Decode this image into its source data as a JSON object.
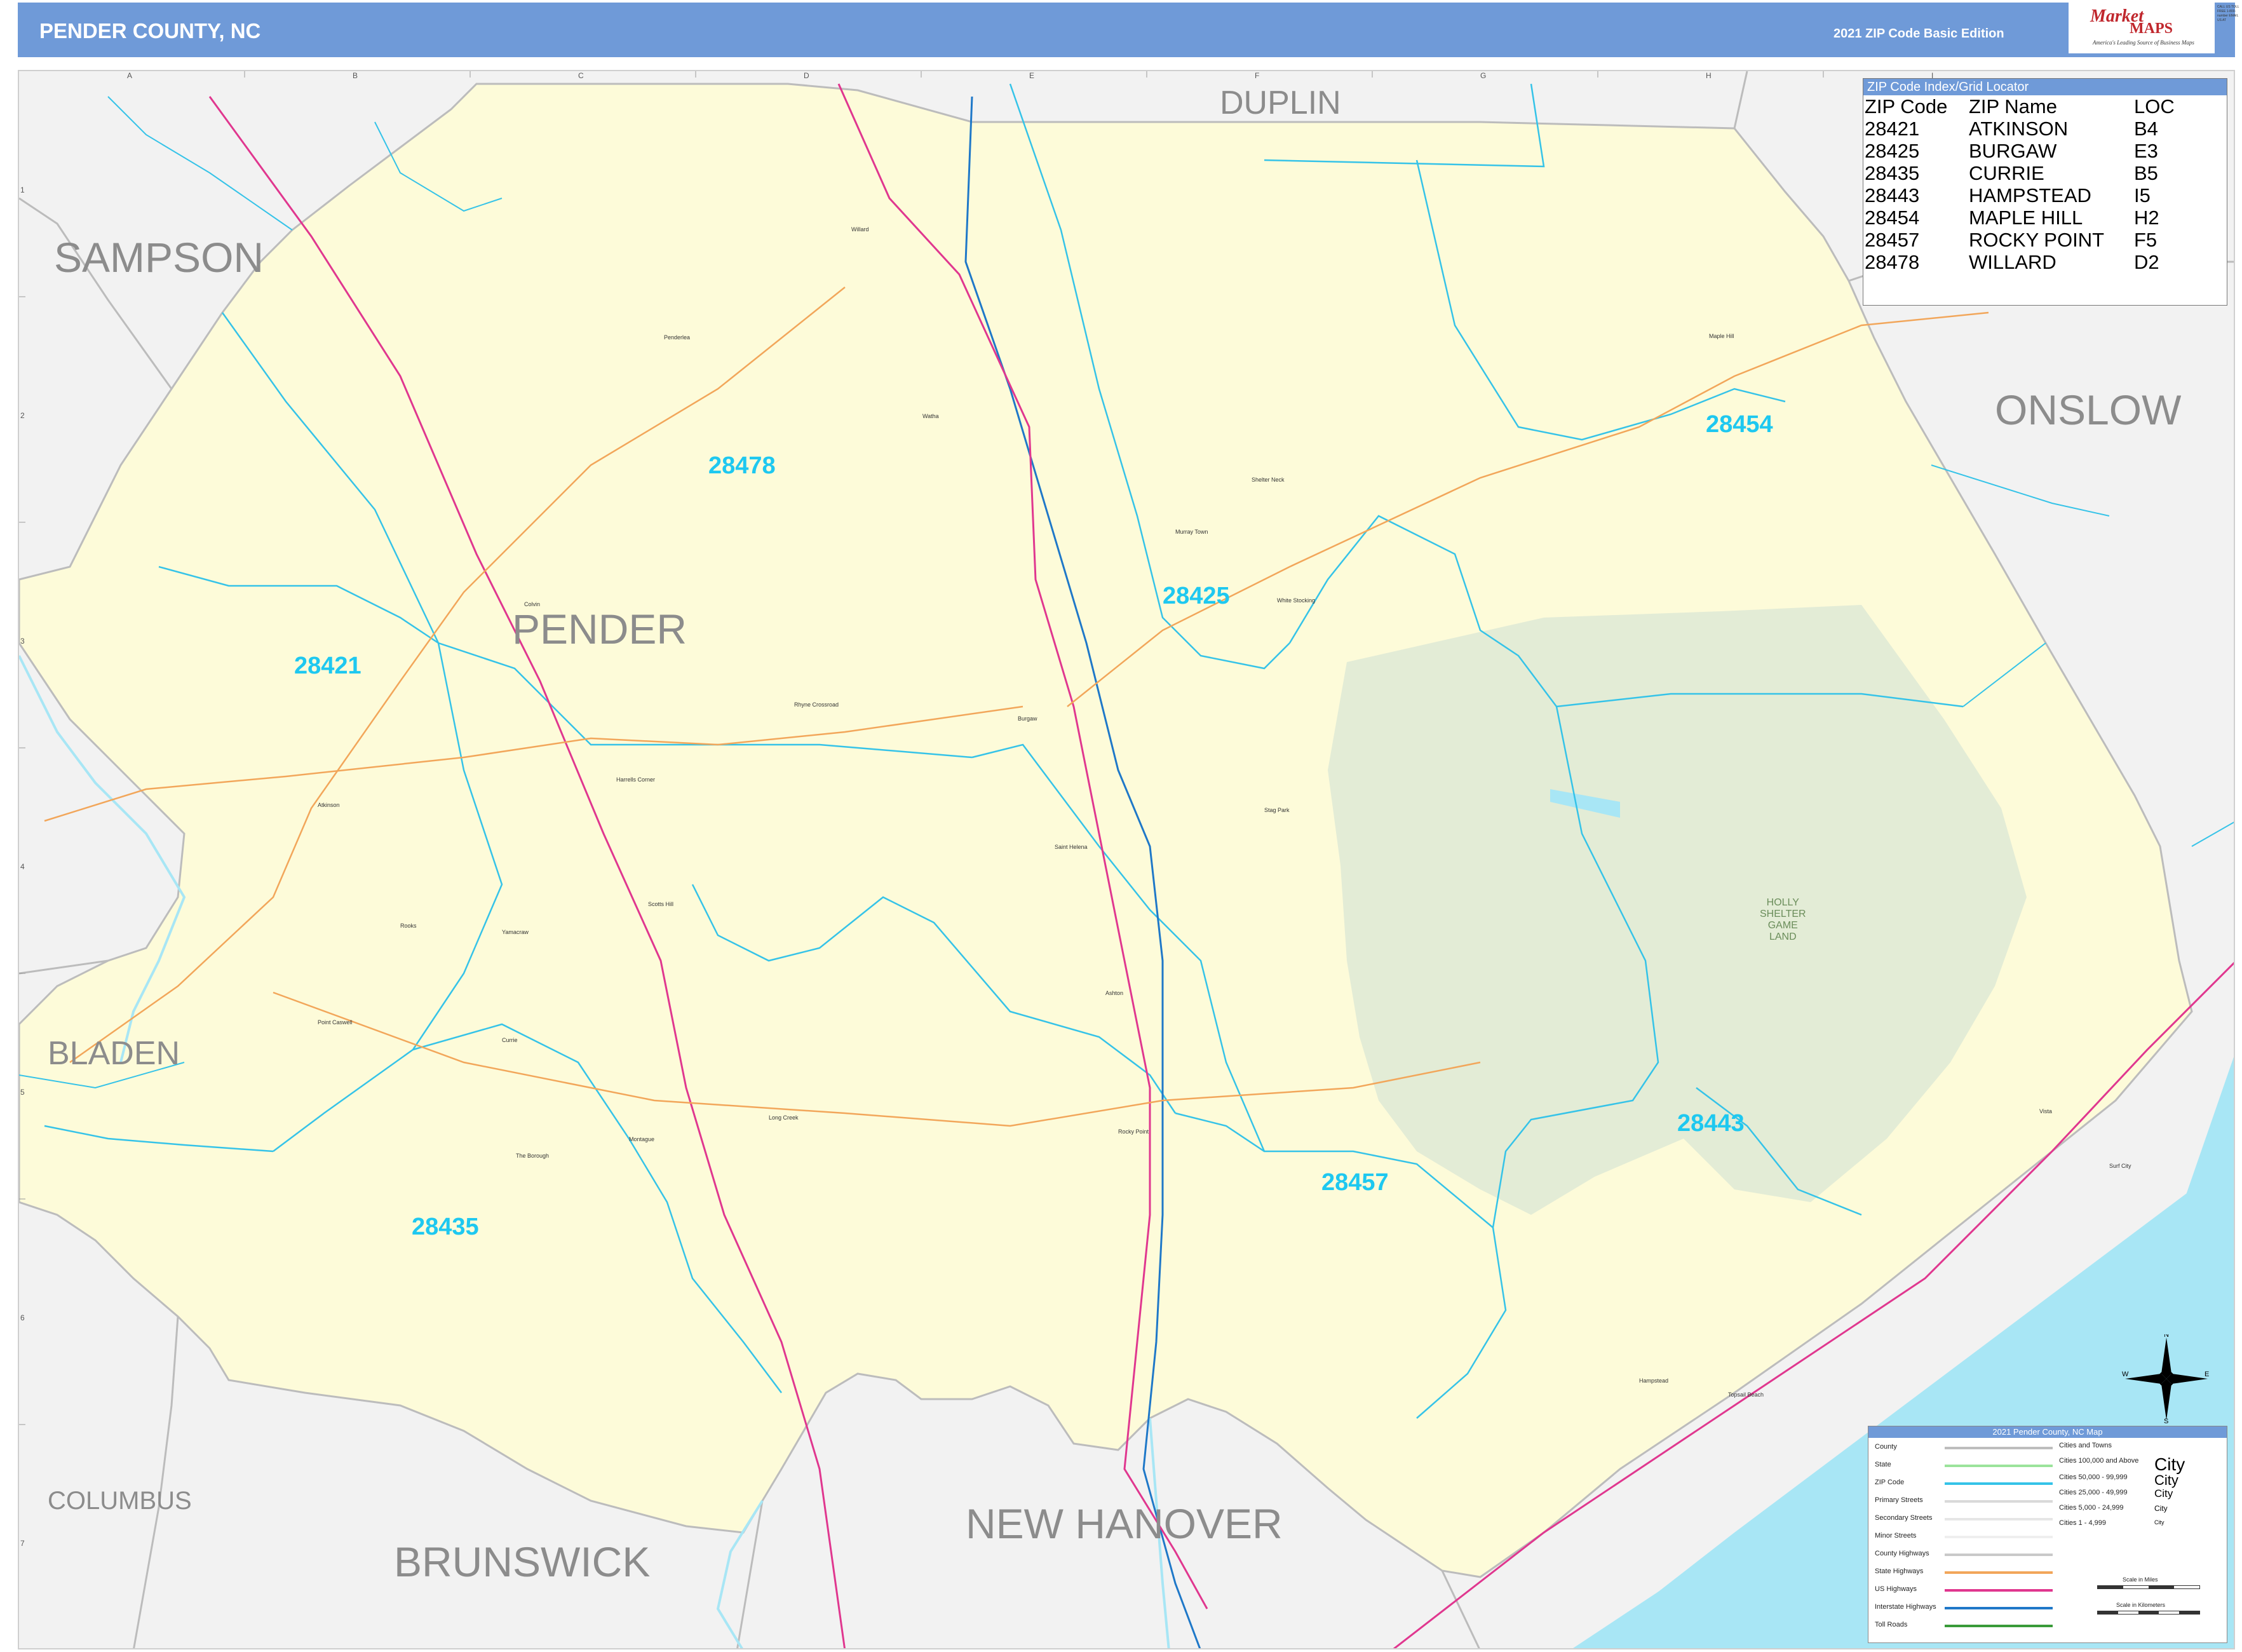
{
  "header": {
    "title": "PENDER COUNTY, NC",
    "edition": "2021 ZIP Code Basic Edition",
    "logo": {
      "main": "Market",
      "sub": "MAPS",
      "tagline": "America's Leading Source of Business Maps",
      "contact": "CALL US TOLL FREE 1-800-number EMAIL US AT"
    }
  },
  "map": {
    "county_labels": {
      "sampson": "SAMPSON",
      "duplin": "DUPLIN",
      "onslow": "ONSLOW",
      "bladen": "BLADEN",
      "columbus": "COLUMBUS",
      "brunswick": "BRUNSWICK",
      "new_hanover": "NEW HANOVER",
      "pender": "PENDER"
    },
    "zip_labels": {
      "z28478": "28478",
      "z28425": "28425",
      "z28421": "28421",
      "z28454": "28454",
      "z28443": "28443",
      "z28457": "28457",
      "z28435": "28435"
    },
    "game_land": {
      "line1": "HOLLY",
      "line2": "SHELTER",
      "line3": "GAME",
      "line4": "LAND"
    },
    "places": {
      "willard": "Willard",
      "maple_hill": "Maple Hill",
      "penderlea": "Penderlea",
      "watha": "Watha",
      "shelter_neck": "Shelter Neck",
      "murray_town": "Murray Town",
      "white_stocking": "White Stocking",
      "burgaw": "Burgaw",
      "rhyne_crossroad": "Rhyne Crossroad",
      "harrells": "Harrells Corner",
      "stag_park": "Stag Park",
      "saint_helena": "Saint Helena",
      "atkinson": "Atkinson",
      "currie": "Currie",
      "point_caswell": "Point Caswell",
      "long_creek": "Long Creek",
      "rocky_point": "Rocky Point",
      "ashton": "Ashton",
      "montague": "Montague",
      "the_borough": "The Borough",
      "hampstead": "Hampstead",
      "topsail_beach": "Topsail Beach",
      "vista": "Vista",
      "surf_city": "Surf City",
      "yamacraw": "Yamacraw",
      "rooks": "Rooks",
      "scotts_hill": "Scotts Hill",
      "colvin": "Colvin"
    },
    "grid_cols": [
      "A",
      "B",
      "C",
      "D",
      "E",
      "F",
      "G",
      "H",
      "I"
    ],
    "grid_rows": [
      "1",
      "2",
      "3",
      "4",
      "5",
      "6",
      "7"
    ]
  },
  "zip_index": {
    "title": "ZIP Code Index/Grid Locator",
    "headers": [
      "ZIP Code",
      "ZIP Name",
      "LOC"
    ],
    "rows": [
      [
        "28421",
        "ATKINSON",
        "B4"
      ],
      [
        "28425",
        "BURGAW",
        "E3"
      ],
      [
        "28435",
        "CURRIE",
        "B5"
      ],
      [
        "28443",
        "HAMPSTEAD",
        "I5"
      ],
      [
        "28454",
        "MAPLE HILL",
        "H2"
      ],
      [
        "28457",
        "ROCKY POINT",
        "F5"
      ],
      [
        "28478",
        "WILLARD",
        "D2"
      ]
    ]
  },
  "legend": {
    "title": "2021 Pender County, NC Map",
    "items": [
      "County",
      "State",
      "ZIP Code",
      "Primary Streets",
      "Secondary Streets",
      "Minor Streets",
      "County Highways",
      "State Highways",
      "US Highways",
      "Interstate Highways",
      "Toll Roads"
    ],
    "colors": [
      "#bdbdbd",
      "#9be39b",
      "#35c3e8",
      "#d9d9d9",
      "#e6e6e6",
      "#efefef",
      "#c9c9c9",
      "#f2a65a",
      "#e0378f",
      "#1f78c8",
      "#3a9b3a"
    ],
    "cities_heading": "Cities and Towns",
    "cities": [
      "Cities 100,000 and Above",
      "Cities 50,000 - 99,999",
      "Cities 25,000 - 49,999",
      "Cities 5,000 - 24,999",
      "Cities 1 - 4,999"
    ],
    "city_samples": [
      "City",
      "City",
      "City",
      "City",
      "City"
    ],
    "scale_miles": "Scale in Miles",
    "scale_km": "Scale in Kilometers"
  },
  "compass": {
    "n": "N",
    "s": "S",
    "e": "E",
    "w": "W"
  }
}
